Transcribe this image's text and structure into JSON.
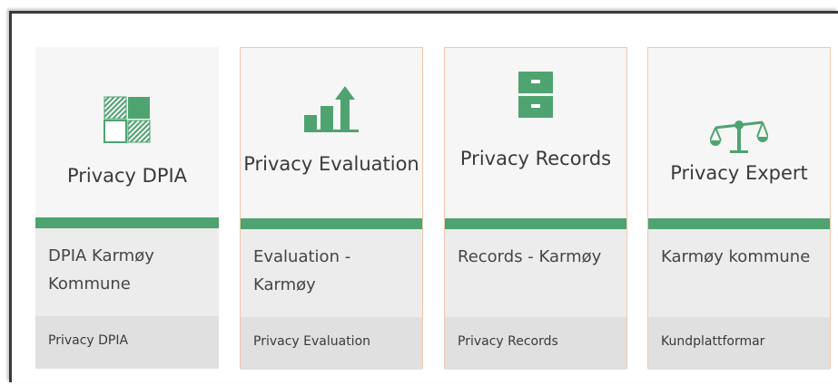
{
  "cards": [
    {
      "title": "Privacy DPIA",
      "subtitle": "DPIA Karmøy Kommune",
      "footer": "Privacy DPIA",
      "icon": "dpia-grid-icon"
    },
    {
      "title": "Privacy Evaluation",
      "subtitle": "Evaluation - Karmøy",
      "footer": "Privacy Evaluation",
      "icon": "bar-chart-arrow-icon"
    },
    {
      "title": "Privacy Records",
      "subtitle": "Records - Karmøy",
      "footer": "Privacy Records",
      "icon": "filing-cabinet-icon"
    },
    {
      "title": "Privacy Expert",
      "subtitle": "Karmøy kommune",
      "footer": "Kundplattformar",
      "icon": "scales-icon"
    }
  ],
  "colors": {
    "accent": "#4fa370",
    "card_head": "#f6f6f6",
    "card_sub": "#ececec",
    "card_foot": "#e0e0e0"
  }
}
